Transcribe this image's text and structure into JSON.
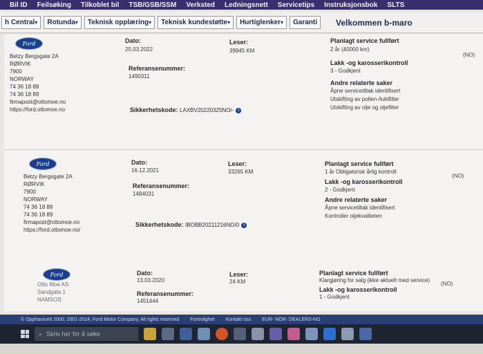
{
  "topmenu": [
    "Bil ID",
    "Feilsøking",
    "Tilkoblet bil",
    "TSB/GSB/SSM",
    "Verksted",
    "Ledningsnett",
    "Servicetips",
    "Instruksjonsbok",
    "SLTS"
  ],
  "navbar": {
    "tabs": [
      "h Central",
      "Rotunda",
      "Teknisk opplæring",
      "Teknisk kundestøtte",
      "Hurtiglenker",
      "Garanti"
    ],
    "welcome": "Velkommen b-maro"
  },
  "labels": {
    "dato": "Dato:",
    "leser": "Leser:",
    "referanse": "Referansenummer:",
    "sikkerhet": "Sikkerhetskode:",
    "planlagt": "Planlagt service fullført",
    "lakk": "Lakk -og karosserikontroll",
    "andre": "Andre relaterte saker"
  },
  "records": [
    {
      "logo": "Ford",
      "address": [
        "Betzy Bergsgate 2A",
        "RØRVIK",
        "7900",
        "NORWAY",
        "74 36 18 88",
        "74 36 18 89",
        "firmapost@ottomoe.no",
        "https://ford.ottomoe.no"
      ],
      "dato": "25.03.2022",
      "leser": "39945 KM",
      "referanse": "1490311",
      "sikkerhetskode": "LAXBV20220325NO/-",
      "planlagt": "2 år (40000 km)",
      "lakk": "3 - Godkjent",
      "andre": [
        "Åpne servicetiltak identifisert",
        "Utskifting av pollen-/luktfilter",
        "Utskifting av olje og oljefilter"
      ],
      "side": "(NO)"
    },
    {
      "logo": "Ford",
      "address": [
        "Betzy Bergsgate 2A",
        "RØRVIK",
        "7900",
        "NORWAY",
        "74 36 18 88",
        "74 36 18 89",
        "firmapost@ottomoe.no",
        "https://ford.ottomoe.no/"
      ],
      "dato": "16.12.2021",
      "leser": "33265 KM",
      "referanse": "1484031",
      "sikkerhetskode": "IBOBB20211216NO/0",
      "planlagt": "1 år Obligatorisk årlig kontroll",
      "lakk": "2 - Godkjent",
      "andre": [
        "Åpne servicetiltak identifisert",
        "Kontroller oljekvaliteten"
      ],
      "side": "(NO)"
    },
    {
      "logo": "Ford",
      "address": [
        "Otto Moe AS",
        "Sandgata 1",
        "NAMSOS"
      ],
      "dato": "13.03.2020",
      "leser": "24 KM",
      "referanse": "1451444",
      "planlagt": "Klargjøring for salg (ikke aktuelt med service)",
      "lakk": "1 - Godkjent",
      "side": "(NO)"
    }
  ],
  "footer": {
    "copyright": "© Opphavsrett 2000, 2001-2024, Ford Motor Company. All rights reserved",
    "privacy": "Fortrolighet",
    "contact": "Kontakt oss",
    "region": "EUR- NOR- DEALERS-NO"
  },
  "taskbar": {
    "search_placeholder": "Skriv her for å søke"
  }
}
